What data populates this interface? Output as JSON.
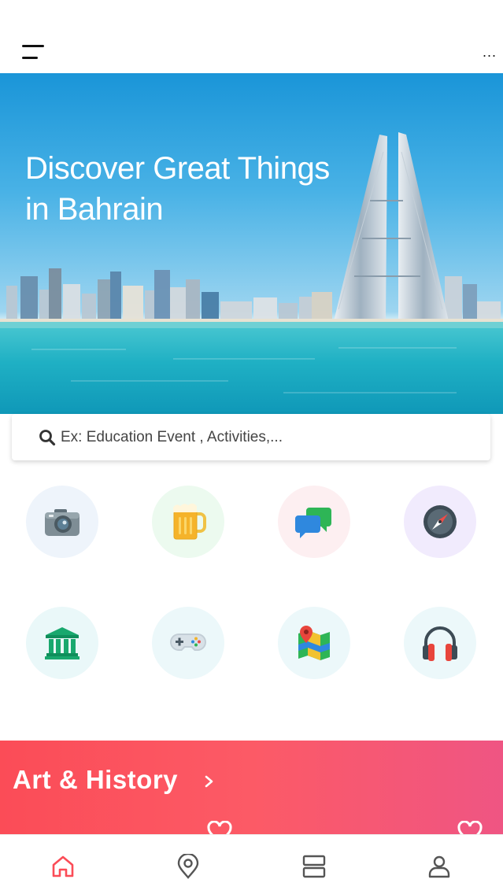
{
  "header": {
    "menu_icon": "hamburger-menu-icon",
    "more_label": "..."
  },
  "hero": {
    "title": "Discover Great Things in Bahrain"
  },
  "search": {
    "placeholder": "Ex: Education Event , Activities,...",
    "icon": "search-icon"
  },
  "categories": [
    {
      "icon": "camera-icon",
      "bg": "#eef4fb"
    },
    {
      "icon": "beer-mug-icon",
      "bg": "#ecfaef"
    },
    {
      "icon": "chat-bubbles-icon",
      "bg": "#fdeff1"
    },
    {
      "icon": "compass-icon",
      "bg": "#f1ebfd"
    },
    {
      "icon": "museum-icon",
      "bg": "#eaf8f9"
    },
    {
      "icon": "gamepad-icon",
      "bg": "#ecf8fa"
    },
    {
      "icon": "map-pin-icon",
      "bg": "#ecf8fa"
    },
    {
      "icon": "headphones-icon",
      "bg": "#ecf8fa"
    }
  ],
  "banner": {
    "title": "Art & History"
  },
  "bottom_nav": [
    {
      "icon": "home-icon",
      "active": true
    },
    {
      "icon": "location-pin-icon",
      "active": false
    },
    {
      "icon": "list-icon",
      "active": false
    },
    {
      "icon": "profile-icon",
      "active": false
    }
  ],
  "colors": {
    "accent": "#fb4c57",
    "banner_end": "#ef5583",
    "inactive_icon": "#555555"
  }
}
